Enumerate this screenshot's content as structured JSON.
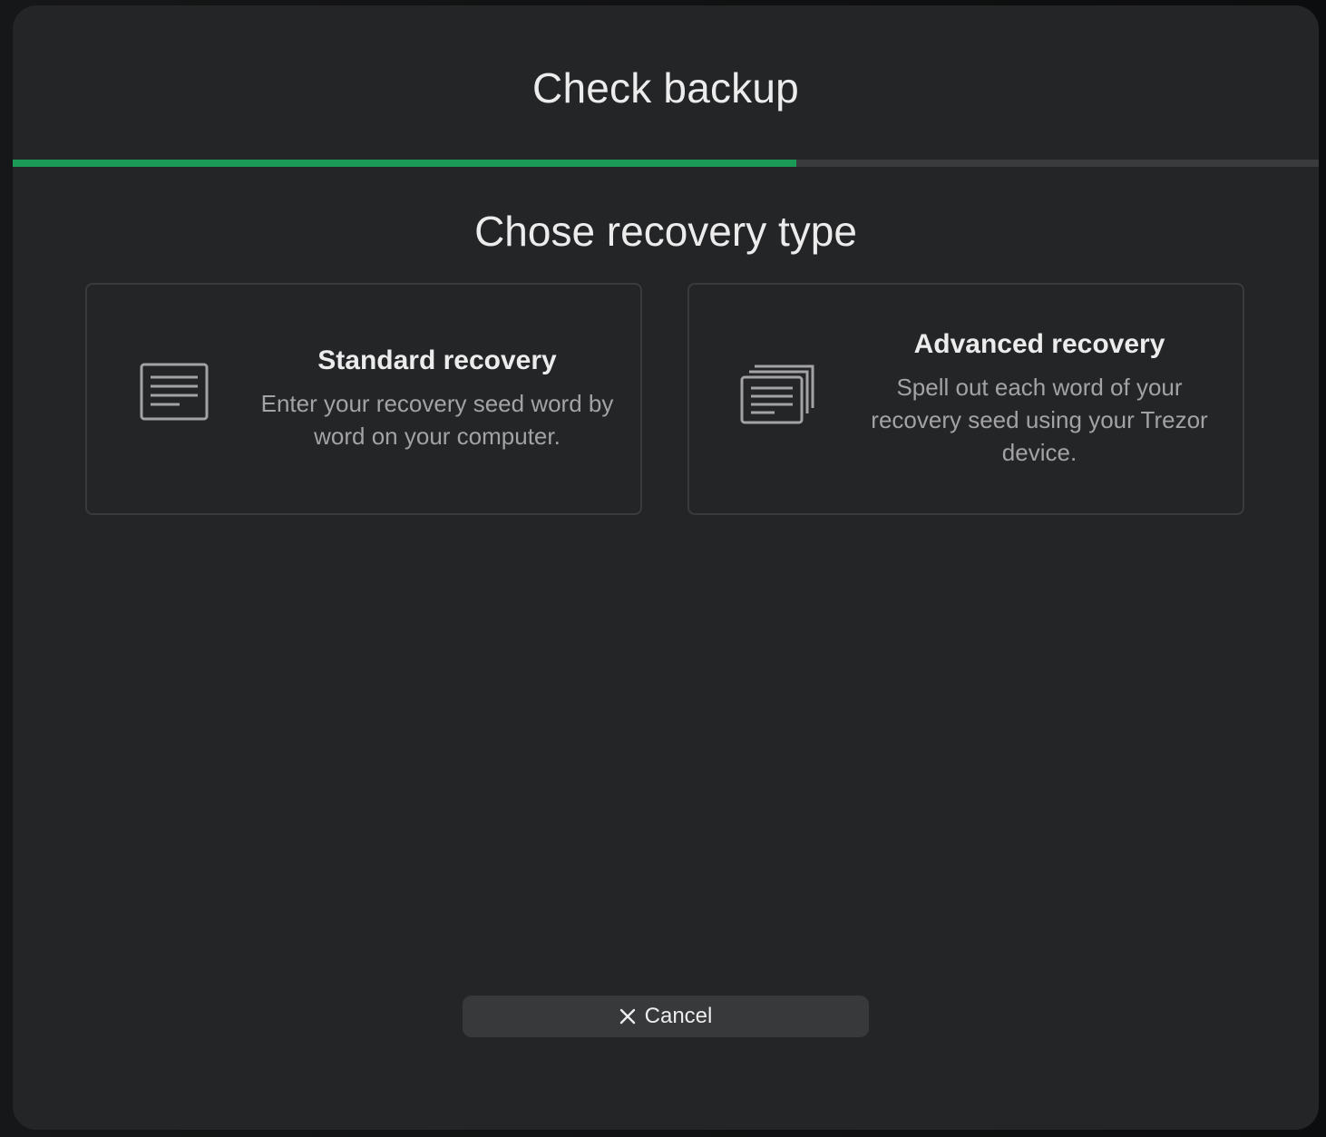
{
  "modal": {
    "title": "Check backup",
    "progress": 0.6
  },
  "section": {
    "heading": "Chose recovery type"
  },
  "options": [
    {
      "title": "Standard recovery",
      "description": "Enter your recovery seed word by word on your computer.",
      "icon": "document-icon"
    },
    {
      "title": "Advanced recovery",
      "description": "Spell out each word of your recovery seed using your Trezor device.",
      "icon": "stacked-documents-icon"
    }
  ],
  "footer": {
    "cancel_label": "Cancel",
    "cancel_icon": "close-icon"
  },
  "colors": {
    "background": "#242527",
    "accent": "#1b9a57",
    "text_primary": "#ececec",
    "text_secondary": "#a3a3a5",
    "border": "#3a3b3d"
  }
}
